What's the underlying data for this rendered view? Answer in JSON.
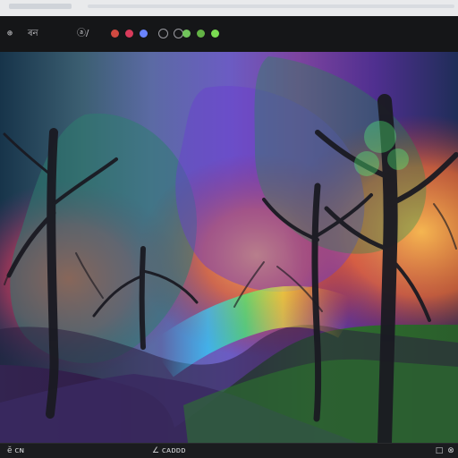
{
  "top": {
    "title_hint": "",
    "subtitle_hint": ""
  },
  "toolbar": {
    "item_a": "⊕",
    "item_b": "ৰন",
    "item_c": "ⓐ/",
    "swatches": [
      "#d04a41",
      "#d83b5b",
      "#6a84ff",
      "#71c45b",
      "#63b345"
    ]
  },
  "status": {
    "left": "ĕ ᴄɴ",
    "right": "∠ ᴄᴀᴅᴅᴅ",
    "icons": [
      "□",
      "⊗"
    ]
  }
}
